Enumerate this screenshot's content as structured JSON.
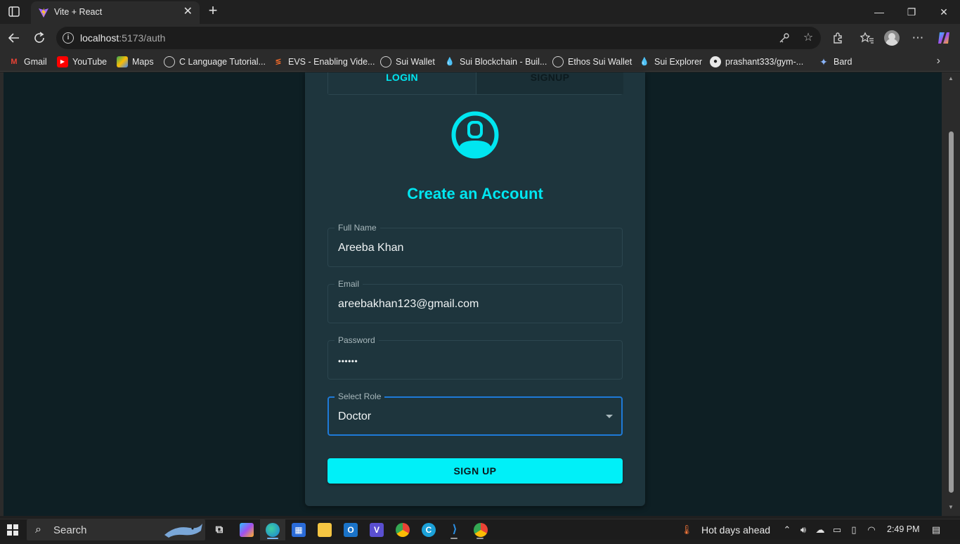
{
  "browser": {
    "tab_title": "Vite + React",
    "tab_close": "✕",
    "new_tab": "+",
    "url_host": "localhost",
    "url_rest": ":5173/auth",
    "window_controls": {
      "minimize": "—",
      "maximize": "❐",
      "close": "✕"
    }
  },
  "bookmarks": [
    {
      "label": "Gmail",
      "icon": "gmail-icon"
    },
    {
      "label": "YouTube",
      "icon": "youtube-icon"
    },
    {
      "label": "Maps",
      "icon": "maps-icon"
    },
    {
      "label": "C Language Tutorial...",
      "icon": "globe-icon"
    },
    {
      "label": "EVS - Enabling Vide...",
      "icon": "evs-icon"
    },
    {
      "label": "Sui Wallet",
      "icon": "globe-icon"
    },
    {
      "label": "Sui Blockchain - Buil...",
      "icon": "sui-drop-icon"
    },
    {
      "label": "Ethos Sui Wallet",
      "icon": "globe-icon"
    },
    {
      "label": "Sui Explorer",
      "icon": "sui-drop-icon"
    },
    {
      "label": "prashant333/gym-...",
      "icon": "github-icon"
    },
    {
      "label": "Bard",
      "icon": "bard-sparkle-icon"
    }
  ],
  "auth": {
    "tab_login": "LOGIN",
    "tab_signup": "SIGNUP",
    "heading": "Create an Account",
    "full_name": {
      "label": "Full Name",
      "value": "Areeba Khan"
    },
    "email": {
      "label": "Email",
      "value": "areebakhan123@gmail.com"
    },
    "password": {
      "label": "Password",
      "value": "••••••"
    },
    "role": {
      "label": "Select Role",
      "value": "Doctor"
    },
    "submit": "SIGN UP"
  },
  "colors": {
    "accent": "#00e6f0",
    "page_bg": "#0e1f24",
    "card_bg": "#1e353d",
    "focus_border": "#1e7ad8",
    "button_bg": "#00f0f8"
  },
  "taskbar": {
    "search_text": "Search",
    "weather_text": "Hot days ahead",
    "time": "2:49 PM"
  }
}
